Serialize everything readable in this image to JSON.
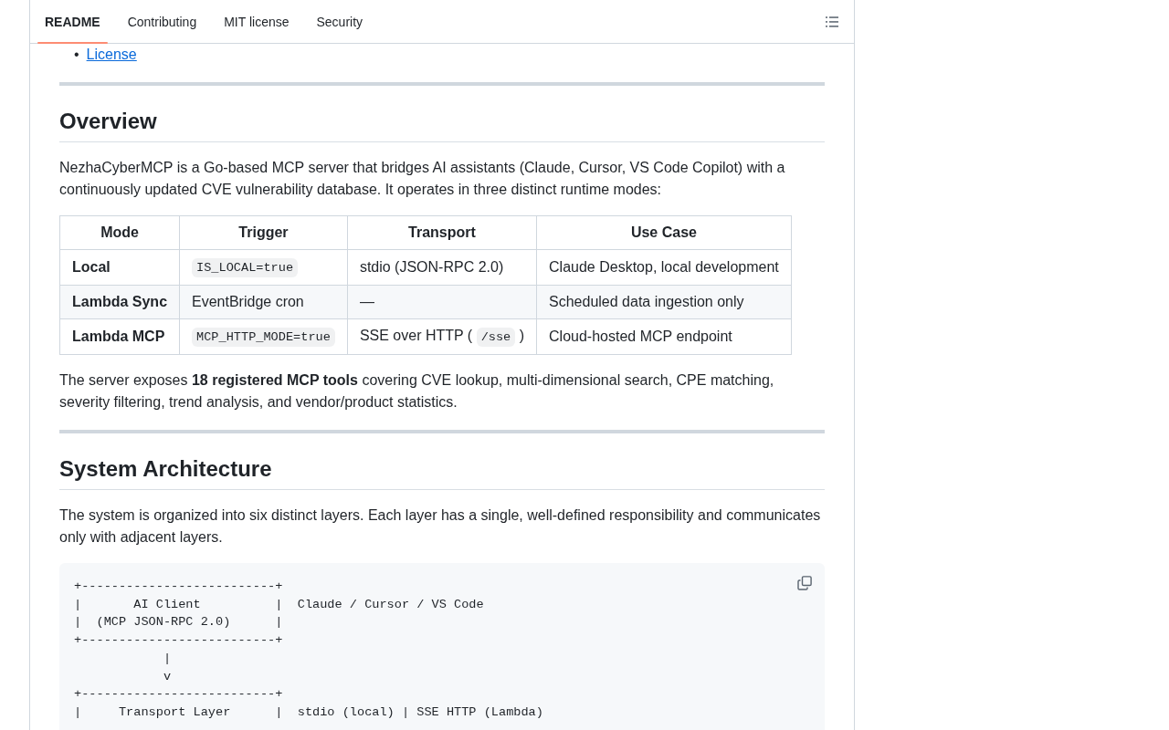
{
  "tabs": [
    {
      "label": "README",
      "selected": true
    },
    {
      "label": "Contributing",
      "selected": false
    },
    {
      "label": "MIT license",
      "selected": false
    },
    {
      "label": "Security",
      "selected": false
    }
  ],
  "readme": {
    "toc_items": [
      {
        "marker": "•",
        "text": "License"
      }
    ],
    "blocks": [
      {
        "kind": "rule"
      },
      {
        "kind": "heading",
        "text": "Overview"
      },
      {
        "kind": "paragraph",
        "text": "NezhaCyberMCP is a Go-based MCP server that bridges AI assistants (Claude, Cursor, VS Code Copilot) with a continuously updated CVE vulnerability database. It operates in three distinct runtime modes:"
      },
      {
        "kind": "table",
        "columns": [
          "Mode",
          "Trigger",
          "Transport",
          "Use Case"
        ],
        "rows": [
          [
            [
              {
                "kind": "strong",
                "text": "Local"
              }
            ],
            [
              {
                "kind": "code",
                "text": "IS_LOCAL=true"
              }
            ],
            [
              {
                "kind": "text",
                "text": "stdio (JSON-RPC 2.0)"
              }
            ],
            [
              {
                "kind": "text",
                "text": "Claude Desktop, local development"
              }
            ]
          ],
          [
            [
              {
                "kind": "strong",
                "text": "Lambda Sync"
              }
            ],
            [
              {
                "kind": "text",
                "text": "EventBridge cron"
              }
            ],
            [
              {
                "kind": "text",
                "text": "—"
              }
            ],
            [
              {
                "kind": "text",
                "text": "Scheduled data ingestion only"
              }
            ]
          ],
          [
            [
              {
                "kind": "strong",
                "text": "Lambda MCP"
              }
            ],
            [
              {
                "kind": "code",
                "text": "MCP_HTTP_MODE=true"
              }
            ],
            [
              {
                "kind": "text",
                "text": "SSE over HTTP ("
              },
              {
                "kind": "code",
                "text": "/sse"
              },
              {
                "kind": "text",
                "text": ")"
              }
            ],
            [
              {
                "kind": "text",
                "text": "Cloud-hosted MCP endpoint"
              }
            ]
          ]
        ]
      },
      {
        "kind": "paragraph",
        "text": "The server exposes **18 registered MCP tools** covering CVE lookup, multi-dimensional search, CPE matching, severity filtering, trend analysis, and vendor/product statistics."
      },
      {
        "kind": "rule"
      },
      {
        "kind": "heading",
        "text": "System Architecture"
      },
      {
        "kind": "paragraph",
        "text": "The system is organized into six distinct layers. Each layer has a single, well-defined responsibility and communicates only with adjacent layers."
      },
      {
        "kind": "code_block",
        "lines": [
          "+--------------------------+",
          "|       AI Client          |  Claude / Cursor / VS Code",
          "|  (MCP JSON-RPC 2.0)      |",
          "+--------------------------+",
          "            |",
          "            v",
          "+--------------------------+",
          "|     Transport Layer      |  stdio (local) | SSE HTTP (Lambda)"
        ]
      }
    ]
  }
}
